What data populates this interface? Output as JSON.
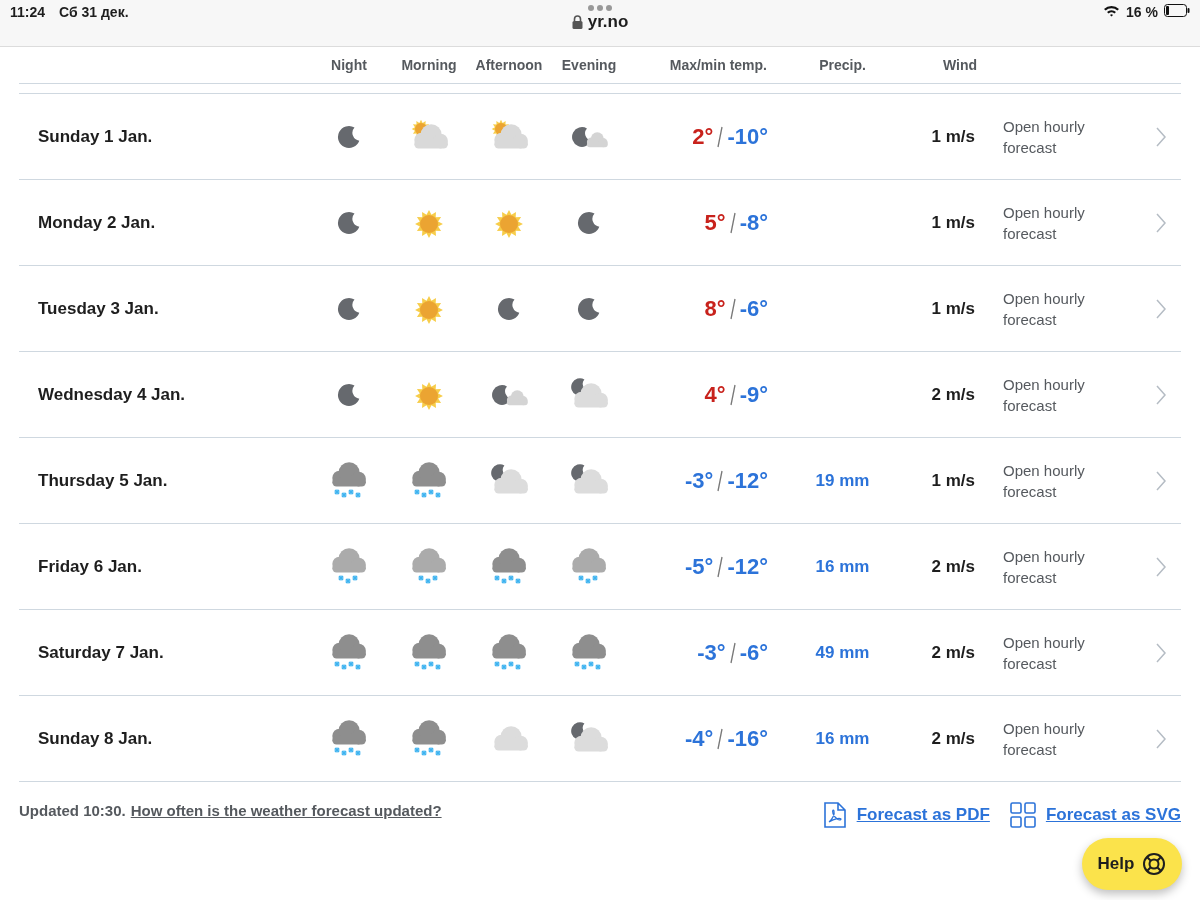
{
  "status_bar": {
    "time": "11:24",
    "date": "Сб 31 дек.",
    "url": "yr.no",
    "battery_text": "16 %"
  },
  "columns": [
    "Night",
    "Morning",
    "Afternoon",
    "Evening",
    "Max/min temp.",
    "Precip.",
    "Wind"
  ],
  "rows": [
    {
      "day": "Sunday 1 Jan.",
      "icons": [
        {
          "kind": "moon"
        },
        {
          "kind": "sun-cloud"
        },
        {
          "kind": "sun-cloud"
        },
        {
          "kind": "moon-small-cloud"
        }
      ],
      "max": "2°",
      "max_warm": true,
      "min": "-10°",
      "min_warm": false,
      "wind": "1 m/s",
      "link": "Open hourly forecast"
    },
    {
      "day": "Monday 2 Jan.",
      "icons": [
        {
          "kind": "moon"
        },
        {
          "kind": "sun"
        },
        {
          "kind": "sun"
        },
        {
          "kind": "moon"
        }
      ],
      "max": "5°",
      "max_warm": true,
      "min": "-8°",
      "min_warm": false,
      "wind": "1 m/s",
      "link": "Open hourly forecast"
    },
    {
      "day": "Tuesday 3 Jan.",
      "icons": [
        {
          "kind": "moon"
        },
        {
          "kind": "sun"
        },
        {
          "kind": "moon"
        },
        {
          "kind": "moon"
        }
      ],
      "max": "8°",
      "max_warm": true,
      "min": "-6°",
      "min_warm": false,
      "wind": "1 m/s",
      "link": "Open hourly forecast"
    },
    {
      "day": "Wednesday 4 Jan.",
      "icons": [
        {
          "kind": "moon"
        },
        {
          "kind": "sun"
        },
        {
          "kind": "moon-small-cloud"
        },
        {
          "kind": "moon-cloud"
        }
      ],
      "max": "4°",
      "max_warm": true,
      "min": "-9°",
      "min_warm": false,
      "wind": "2 m/s",
      "link": "Open hourly forecast"
    },
    {
      "day": "Thursday 5 Jan.",
      "icons": [
        {
          "kind": "snow"
        },
        {
          "kind": "snow"
        },
        {
          "kind": "moon-cloud"
        },
        {
          "kind": "moon-cloud"
        }
      ],
      "max": "-3°",
      "max_warm": false,
      "min": "-12°",
      "min_warm": false,
      "precip": "19 mm",
      "wind": "1 m/s",
      "link": "Open hourly forecast"
    },
    {
      "day": "Friday 6 Jan.",
      "icons": [
        {
          "kind": "light-snow"
        },
        {
          "kind": "light-snow"
        },
        {
          "kind": "snow"
        },
        {
          "kind": "light-snow"
        }
      ],
      "max": "-5°",
      "max_warm": false,
      "min": "-12°",
      "min_warm": false,
      "precip": "16 mm",
      "wind": "2 m/s",
      "link": "Open hourly forecast"
    },
    {
      "day": "Saturday 7 Jan.",
      "icons": [
        {
          "kind": "snow"
        },
        {
          "kind": "snow"
        },
        {
          "kind": "snow"
        },
        {
          "kind": "snow"
        }
      ],
      "max": "-3°",
      "max_warm": false,
      "min": "-6°",
      "min_warm": false,
      "precip": "49 mm",
      "wind": "2 m/s",
      "link": "Open hourly forecast"
    },
    {
      "day": "Sunday 8 Jan.",
      "icons": [
        {
          "kind": "snow"
        },
        {
          "kind": "snow"
        },
        {
          "kind": "cloud"
        },
        {
          "kind": "moon-cloud"
        }
      ],
      "max": "-4°",
      "max_warm": false,
      "min": "-16°",
      "min_warm": false,
      "precip": "16 mm",
      "wind": "2 m/s",
      "link": "Open hourly forecast"
    }
  ],
  "footer": {
    "updated": "Updated 10:30.",
    "faq_link": "How often is the weather forecast updated?",
    "pdf_link": "Forecast as PDF",
    "svg_link": "Forecast as SVG"
  },
  "help_button": "Help"
}
